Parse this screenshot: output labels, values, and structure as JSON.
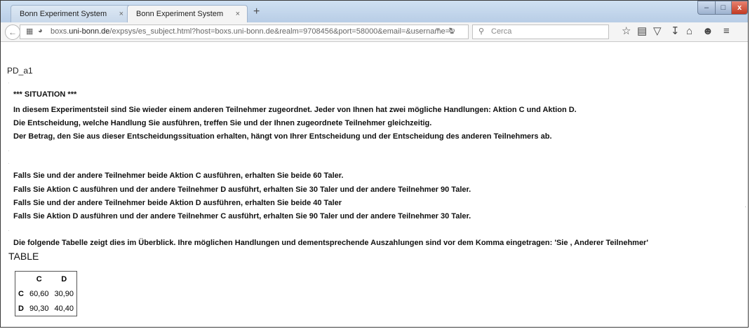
{
  "tabs": [
    {
      "label": "Bonn Experiment System",
      "close": "×"
    },
    {
      "label": "Bonn Experiment System",
      "close": "×"
    }
  ],
  "new_tab": "+",
  "window_controls": {
    "minimize": "–",
    "maximize": "□",
    "close": "x"
  },
  "url": {
    "host": "boxs.uni-bonn.de",
    "host_pre": "boxs.",
    "host_bold": "uni-bonn.de",
    "path": "/expsys/es_subject.html?host=boxs.uni-bonn.de&realm=9708456&port=58000&email=&username=1"
  },
  "search": {
    "placeholder": "Cerca"
  },
  "page": {
    "id": "PD_a1",
    "situation_heading": "*** SITUATION ***",
    "intro": [
      "In diesem Experimentsteil sind Sie wieder einem anderen Teilnehmer zugeordnet. Jeder von Ihnen hat zwei mögliche Handlungen: Aktion C und Aktion D.",
      "Die Entscheidung, welche Handlung Sie ausführen, treffen Sie und der Ihnen zugeordnete Teilnehmer gleichzeitig.",
      "Der Betrag, den Sie aus dieser Entscheidungssituation erhalten, hängt von Ihrer Entscheidung und der Entscheidung des anderen Teilnehmers ab."
    ],
    "outcomes": [
      "Falls Sie und der andere Teilnehmer beide Aktion C ausführen, erhalten Sie beide 60 Taler.",
      "Falls Sie Aktion C ausführen und der andere Teilnehmer D ausführt, erhalten Sie 30 Taler und der andere Teilnehmer 90 Taler.",
      "Falls Sie und der andere Teilnehmer beide Aktion D ausführen, erhalten Sie beide 40 Taler",
      "Falls Sie Aktion D ausführen und der andere Teilnehmer C ausführt, erhalten Sie 90 Taler und der andere Teilnehmer 30 Taler."
    ],
    "table_intro": "Die folgende Tabelle zeigt dies im Überblick. Ihre möglichen Handlungen und dementsprechende Auszahlungen sind vor dem Komma eingetragen: 'Sie , Anderer Teilnehmer'",
    "table_label": "TABLE",
    "table": {
      "columns": [
        "C",
        "D"
      ],
      "rows": [
        {
          "label": "C",
          "cells": [
            "60,60",
            "30,90"
          ]
        },
        {
          "label": "D",
          "cells": [
            "90,30",
            "40,40"
          ]
        }
      ]
    }
  }
}
